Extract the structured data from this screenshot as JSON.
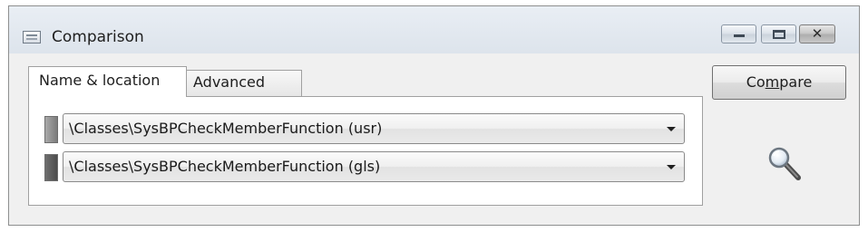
{
  "window": {
    "title": "Comparison",
    "controls": {
      "minimize": "minimize",
      "maximize": "maximize",
      "close": "close"
    },
    "close_glyph": "✕"
  },
  "tabs": [
    {
      "label": "Name & location",
      "active": true
    },
    {
      "label": "Advanced",
      "active": false
    }
  ],
  "selections": [
    {
      "value": "\\Classes\\SysBPCheckMemberFunction (usr)",
      "swatch_color": "#8f8f8f"
    },
    {
      "value": "\\Classes\\SysBPCheckMemberFunction (gls)",
      "swatch_color": "#5a5a5a"
    }
  ],
  "compare_button": {
    "pre": "Co",
    "mnemonic": "m",
    "post": "pare"
  },
  "icons": {
    "search": "magnifier-icon"
  }
}
